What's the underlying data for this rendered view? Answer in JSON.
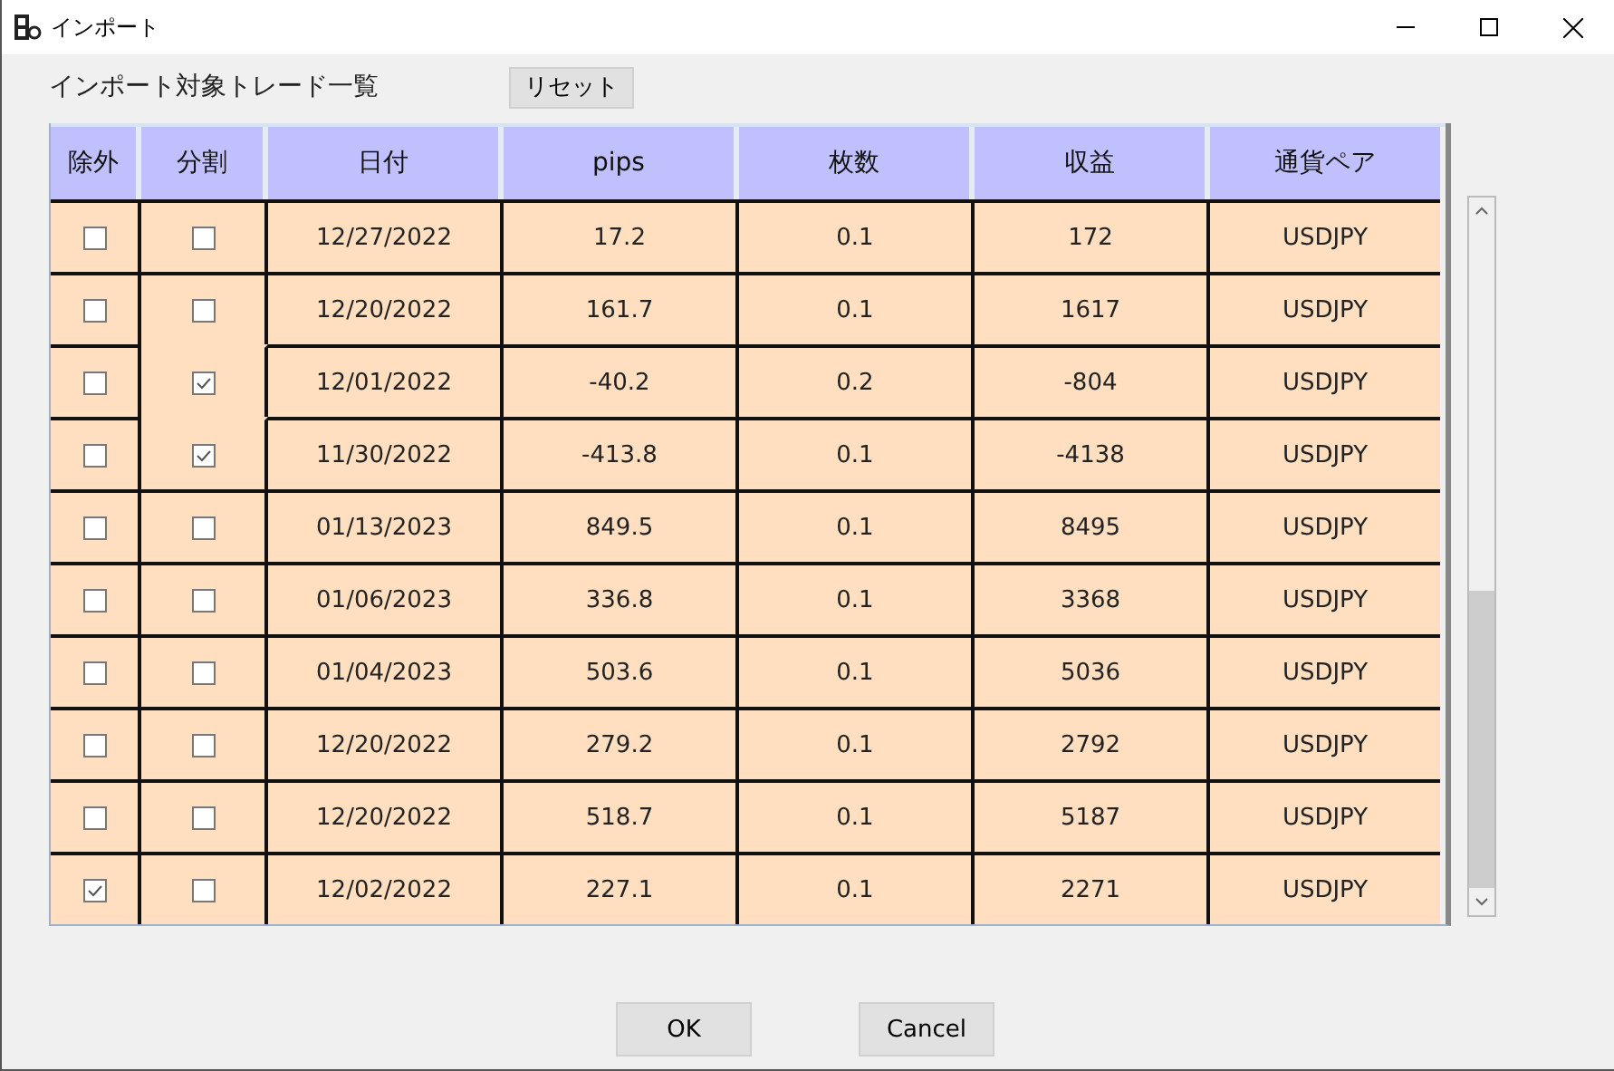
{
  "window": {
    "title": "インポート"
  },
  "heading": "インポート対象トレード一覧",
  "reset_button": "リセット",
  "table": {
    "columns": [
      "除外",
      "分割",
      "日付",
      "pips",
      "枚数",
      "収益",
      "通貨ペア"
    ],
    "rows": [
      {
        "excluded": false,
        "split": false,
        "date": "12/27/2022",
        "pips": "17.2",
        "lots": "0.1",
        "profit": "172",
        "pair": "USDJPY"
      },
      {
        "excluded": false,
        "split": false,
        "date": "12/20/2022",
        "pips": "161.7",
        "lots": "0.1",
        "profit": "1617",
        "pair": "USDJPY"
      },
      {
        "excluded": false,
        "split": true,
        "split_joined": true,
        "date": "12/01/2022",
        "pips": "-40.2",
        "lots": "0.2",
        "profit": "-804",
        "pair": "USDJPY"
      },
      {
        "excluded": false,
        "split": true,
        "split_joined": true,
        "date": "11/30/2022",
        "pips": "-413.8",
        "lots": "0.1",
        "profit": "-4138",
        "pair": "USDJPY"
      },
      {
        "excluded": false,
        "split": false,
        "date": "01/13/2023",
        "pips": "849.5",
        "lots": "0.1",
        "profit": "8495",
        "pair": "USDJPY"
      },
      {
        "excluded": false,
        "split": false,
        "date": "01/06/2023",
        "pips": "336.8",
        "lots": "0.1",
        "profit": "3368",
        "pair": "USDJPY"
      },
      {
        "excluded": false,
        "split": false,
        "date": "01/04/2023",
        "pips": "503.6",
        "lots": "0.1",
        "profit": "5036",
        "pair": "USDJPY"
      },
      {
        "excluded": false,
        "split": false,
        "date": "12/20/2022",
        "pips": "279.2",
        "lots": "0.1",
        "profit": "2792",
        "pair": "USDJPY"
      },
      {
        "excluded": false,
        "split": false,
        "date": "12/20/2022",
        "pips": "518.7",
        "lots": "0.1",
        "profit": "5187",
        "pair": "USDJPY"
      },
      {
        "excluded": true,
        "split": false,
        "date": "12/02/2022",
        "pips": "227.1",
        "lots": "0.1",
        "profit": "2271",
        "pair": "USDJPY"
      }
    ]
  },
  "buttons": [
    "OK",
    "Cancel"
  ]
}
